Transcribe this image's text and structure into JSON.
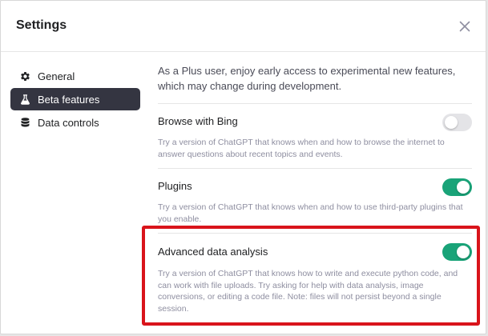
{
  "dialog": {
    "title": "Settings",
    "close_icon": "close-icon"
  },
  "sidebar": {
    "items": [
      {
        "label": "General",
        "icon": "gear-icon",
        "active": false
      },
      {
        "label": "Beta features",
        "icon": "flask-icon",
        "active": true
      },
      {
        "label": "Data controls",
        "icon": "database-icon",
        "active": false
      }
    ]
  },
  "content": {
    "intro": "As a Plus user, enjoy early access to experimental new features, which may change during development.",
    "features": [
      {
        "title": "Browse with Bing",
        "description": "Try a version of ChatGPT that knows when and how to browse the internet to answer questions about recent topics and events.",
        "enabled": false
      },
      {
        "title": "Plugins",
        "description": "Try a version of ChatGPT that knows when and how to use third-party plugins that you enable.",
        "enabled": true
      },
      {
        "title": "Advanced data analysis",
        "description": "Try a version of ChatGPT that knows how to write and execute python code, and can work with file uploads. Try asking for help with data analysis, image conversions, or editing a code file. Note: files will not persist beyond a single session.",
        "enabled": true,
        "highlighted": true
      }
    ]
  },
  "colors": {
    "toggle_on": "#19a378",
    "toggle_off": "#e4e4e7",
    "active_nav_bg": "#343541",
    "highlight_border": "#d9141b"
  }
}
